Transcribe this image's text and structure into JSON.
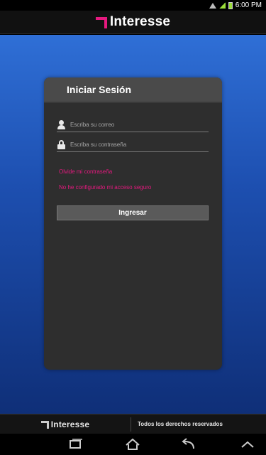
{
  "status_bar": {
    "time": "6:00 PM"
  },
  "app_bar": {
    "logo_text": "Interesse"
  },
  "login": {
    "title": "Iniciar Sesión",
    "email_placeholder": "Escriba su correo",
    "password_placeholder": "Escriba su contraseña",
    "forgot_password": "Olvide mi contraseña",
    "secure_access_not_configured": "No he configurado mi acceso seguro",
    "submit_label": "Ingresar"
  },
  "footer": {
    "logo_text": "Interesse",
    "rights": "Todos los derechos reservados"
  },
  "nav_bar": {
    "icons": [
      "recent-apps-icon",
      "home-icon",
      "back-icon",
      "up-icon"
    ]
  },
  "colors": {
    "accent": "#e6197f",
    "background_top": "#2f6fd6",
    "background_bottom": "#0f2f78",
    "card": "#2e2e2e",
    "card_header": "#4a4a4a"
  }
}
